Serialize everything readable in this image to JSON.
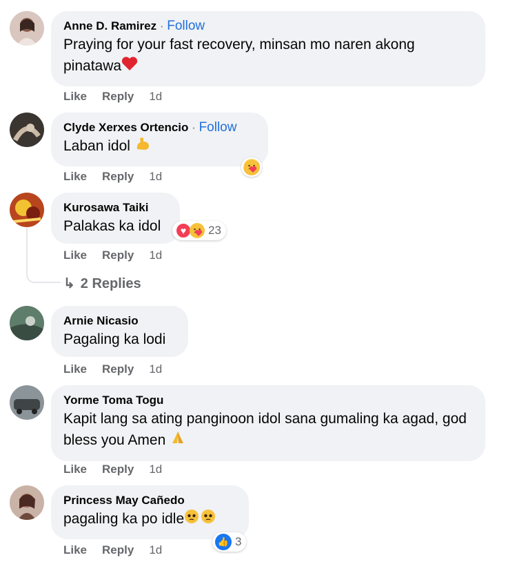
{
  "comments": [
    {
      "author": "Anne D. Ramirez",
      "follow_label": "Follow",
      "text": "Praying for your fast recovery, minsan mo naren akong pinatawa",
      "emoji": "red-heart",
      "like_label": "Like",
      "reply_label": "Reply",
      "time": "1d"
    },
    {
      "author": "Clyde Xerxes Ortencio",
      "follow_label": "Follow",
      "text": "Laban idol",
      "emoji": "flexed-biceps",
      "reaction_icons": [
        "care-icon"
      ],
      "like_label": "Like",
      "reply_label": "Reply",
      "time": "1d"
    },
    {
      "author": "Kurosawa Taiki",
      "text": "Palakas ka idol",
      "reaction_icons": [
        "love-icon",
        "care-icon"
      ],
      "reaction_count": "23",
      "like_label": "Like",
      "reply_label": "Reply",
      "time": "1d",
      "replies_label": "2 Replies"
    },
    {
      "author": "Arnie Nicasio",
      "text": "Pagaling ka lodi",
      "like_label": "Like",
      "reply_label": "Reply",
      "time": "1d"
    },
    {
      "author": "Yorme Toma Togu",
      "text": "Kapit lang sa ating panginoon idol sana gumaling ka agad, god bless you Amen",
      "emoji": "folded-hands",
      "like_label": "Like",
      "reply_label": "Reply",
      "time": "1d"
    },
    {
      "author": "Princess May Cañedo",
      "text": "pagaling ka po idle",
      "emoji": "pleading-face",
      "reaction_icons": [
        "like-icon"
      ],
      "reaction_count": "3",
      "like_label": "Like",
      "reply_label": "Reply",
      "time": "1d"
    }
  ],
  "colors": {
    "bubble": "#f0f2f5",
    "follow": "#216fdb",
    "meta": "#65676b",
    "text": "#050505"
  }
}
